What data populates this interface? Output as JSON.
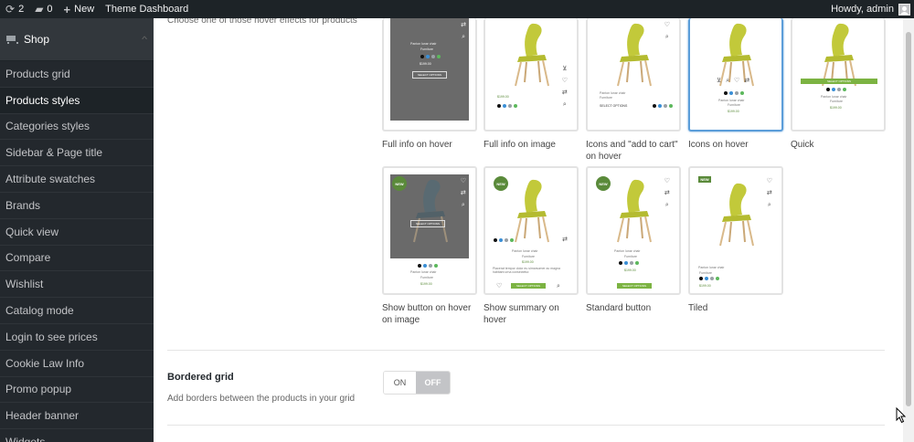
{
  "adminbar": {
    "updates_count": "2",
    "comments_count": "0",
    "new_label": "New",
    "site_name": "Theme Dashboard",
    "howdy": "Howdy, admin"
  },
  "sidebar": {
    "menu_title": "Shop",
    "items": [
      {
        "label": "Products grid"
      },
      {
        "label": "Products styles"
      },
      {
        "label": "Categories styles"
      },
      {
        "label": "Sidebar & Page title"
      },
      {
        "label": "Attribute swatches"
      },
      {
        "label": "Brands"
      },
      {
        "label": "Quick view"
      },
      {
        "label": "Compare"
      },
      {
        "label": "Wishlist"
      },
      {
        "label": "Catalog mode"
      },
      {
        "label": "Login to see prices"
      },
      {
        "label": "Cookie Law Info"
      },
      {
        "label": "Promo popup"
      },
      {
        "label": "Header banner"
      },
      {
        "label": "Widgets"
      }
    ],
    "active_item": "Products styles"
  },
  "main": {
    "hover_description": "Choose one of those hover effects for products",
    "hover_options": [
      {
        "label": "Full info on hover"
      },
      {
        "label": "Full info on image"
      },
      {
        "label": "Icons and \"add to cart\" on hover"
      },
      {
        "label": "Icons on hover"
      },
      {
        "label": "Quick"
      },
      {
        "label": "Show button on hover on image"
      },
      {
        "label": "Show summary on hover"
      },
      {
        "label": "Standard button"
      },
      {
        "label": "Tiled"
      }
    ],
    "selected_option": "Icons on hover",
    "bordered_grid": {
      "title": "Bordered grid",
      "description": "Add borders between the products in your grid",
      "on_label": "ON",
      "off_label": "OFF",
      "value": "OFF"
    }
  },
  "preview": {
    "product_name": "Panton lunar chair",
    "category": "Furniture",
    "price": "$199.00",
    "button_label": "SELECT OPTIONS",
    "badge_new": "NEW",
    "summary_text": "Placerat tempor dolor eu simarsomer ac magna habitant urna consectetur.",
    "swatch_colors": [
      "#111111",
      "#3a8fd6",
      "#9aa0a6",
      "#5cb85c"
    ]
  },
  "colors": {
    "adminbar_bg": "#1d2327",
    "sidebar_bg": "#23282d",
    "accent_green": "#7cb342",
    "selected_border": "#5b9dd9"
  }
}
